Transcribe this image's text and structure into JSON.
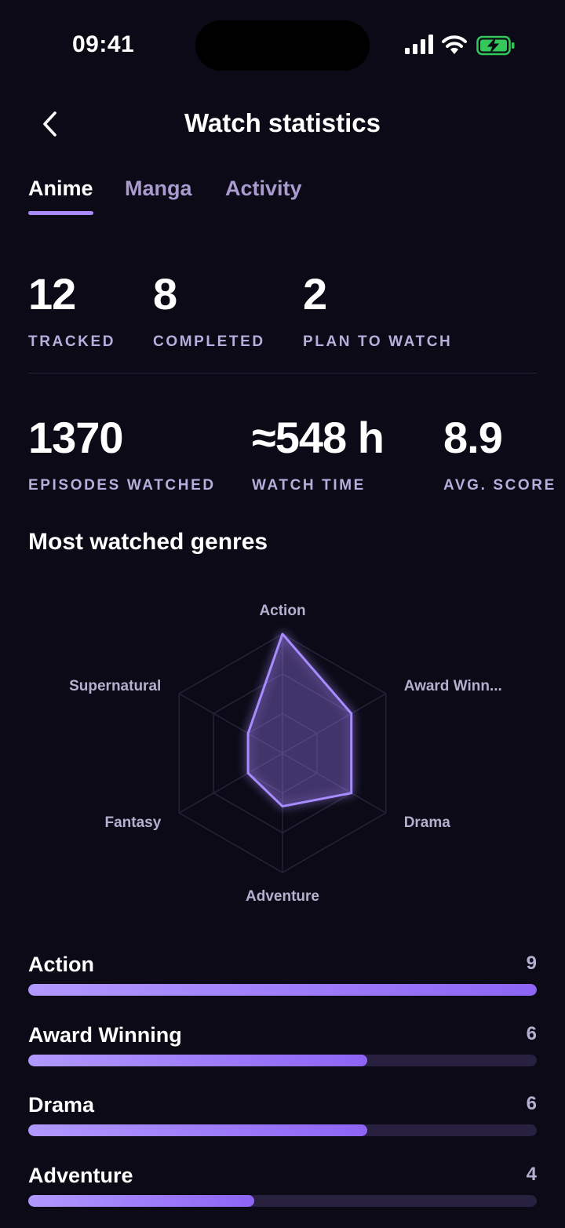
{
  "status_bar": {
    "time": "09:41"
  },
  "header": {
    "title": "Watch statistics"
  },
  "tabs": [
    {
      "label": "Anime",
      "active": true
    },
    {
      "label": "Manga",
      "active": false
    },
    {
      "label": "Activity",
      "active": false
    }
  ],
  "stats_row1": [
    {
      "value": "12",
      "label": "TRACKED"
    },
    {
      "value": "8",
      "label": "COMPLETED"
    },
    {
      "value": "2",
      "label": "PLAN TO WATCH"
    }
  ],
  "stats_row2": [
    {
      "value": "1370",
      "label": "EPISODES WATCHED"
    },
    {
      "value": "≈548 h",
      "label": "WATCH TIME"
    },
    {
      "value": "8.9",
      "label": "AVG. SCORE"
    }
  ],
  "genres_section": {
    "title": "Most watched genres"
  },
  "chart_data": {
    "type": "radar",
    "axes": [
      "Action",
      "Award Winn...",
      "Drama",
      "Adventure",
      "Fantasy",
      "Supernatural"
    ],
    "values": [
      9,
      6,
      6,
      4,
      3,
      3
    ],
    "max": 9,
    "grid_levels": 3
  },
  "genre_bars": {
    "max": 9,
    "items": [
      {
        "name": "Action",
        "count": 9
      },
      {
        "name": "Award Winning",
        "count": 6
      },
      {
        "name": "Drama",
        "count": 6
      },
      {
        "name": "Adventure",
        "count": 4
      }
    ]
  },
  "colors": {
    "background": "#0b0a16",
    "accent": "#a98bff",
    "muted": "#b6afcf",
    "track": "#27213f"
  },
  "icons": {
    "back": "chevron-left-icon",
    "signal": "signal-icon",
    "wifi": "wifi-icon",
    "battery": "battery-charging-icon"
  }
}
